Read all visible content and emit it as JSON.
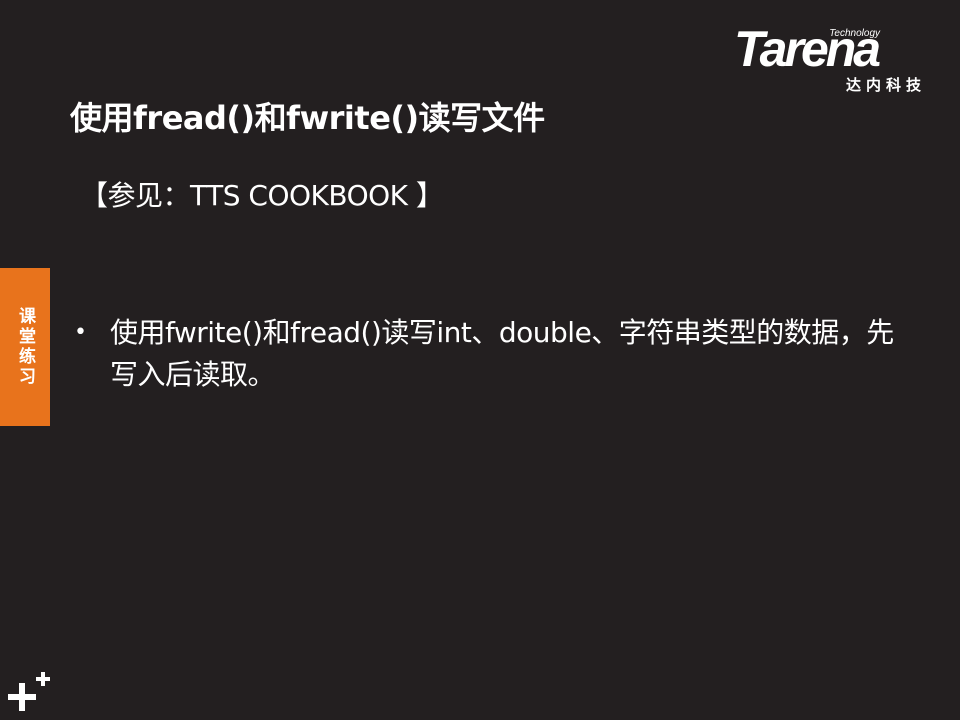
{
  "logo": {
    "technology": "Technology",
    "wordmark": "Tarena",
    "chinese": "达内科技"
  },
  "title": "使用fread()和fwrite()读写文件",
  "reference": "【参见：TTS COOKBOOK 】",
  "side_tab": {
    "label": "课堂练习",
    "color": "#e8731c"
  },
  "bullets": [
    {
      "marker": "•",
      "text": "使用fwrite()和fread()读写int、double、字符串类型的数据，先写入后读取。"
    }
  ],
  "icons": {
    "corner": "plus-plus-icon"
  },
  "colors": {
    "background": "#231f20",
    "text": "#ffffff",
    "accent": "#e8731c"
  }
}
